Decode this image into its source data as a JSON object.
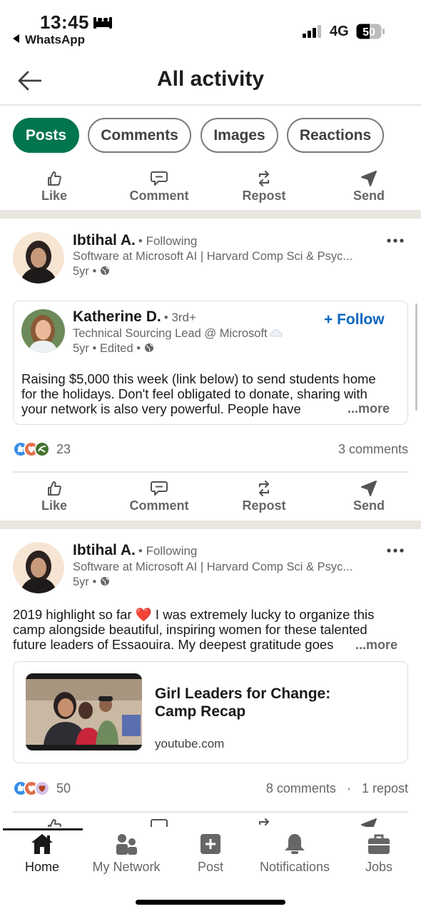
{
  "status_bar": {
    "time": "13:45",
    "back_app": "WhatsApp",
    "network": "4G",
    "battery": "50"
  },
  "header": {
    "title": "All activity"
  },
  "filters": [
    {
      "label": "Posts",
      "active": true
    },
    {
      "label": "Comments",
      "active": false
    },
    {
      "label": "Images",
      "active": false
    },
    {
      "label": "Reactions",
      "active": false
    }
  ],
  "action_labels": {
    "like": "Like",
    "comment": "Comment",
    "repost": "Repost",
    "send": "Send"
  },
  "posts": [
    {
      "author": "Ibtihal A.",
      "relation": "• Following",
      "headline": "Software at Microsoft AI | Harvard Comp Sci & Psyc...",
      "age": "5yr •",
      "reshared": {
        "author": "Katherine D.",
        "degree": "• 3rd+",
        "follow_label": "+ Follow",
        "headline": "Technical Sourcing Lead @ Microsoft",
        "age": "5yr • Edited •",
        "text_lines": [
          "Raising $5,000 this week (link below) to send students home",
          "for the holidays. Don't feel obligated to donate, sharing with",
          "your network is also very powerful. People have"
        ],
        "more": "...more"
      },
      "reaction_count": "23",
      "comments": "3 comments"
    },
    {
      "author": "Ibtihal A.",
      "relation": "• Following",
      "headline": "Software at Microsoft AI | Harvard Comp Sci & Psyc...",
      "age": "5yr •",
      "text_lines": [
        "2019 highlight so far ❤️ I was extremely lucky to organize this",
        "camp alongside beautiful, inspiring women for these talented",
        "future leaders of Essaouira. My deepest gratitude goes"
      ],
      "more": "...more",
      "link": {
        "title_line1": "Girl Leaders for Change:",
        "title_line2": "Camp Recap",
        "domain": "youtube.com"
      },
      "reaction_count": "50",
      "comments": "8 comments",
      "reposts": "1 repost"
    }
  ],
  "bottom_nav": [
    {
      "label": "Home",
      "icon": "home-icon",
      "active": true
    },
    {
      "label": "My Network",
      "icon": "network-icon",
      "active": false
    },
    {
      "label": "Post",
      "icon": "plus-square-icon",
      "active": false
    },
    {
      "label": "Notifications",
      "icon": "bell-icon",
      "active": false
    },
    {
      "label": "Jobs",
      "icon": "briefcase-icon",
      "active": false
    }
  ],
  "colors": {
    "accent_green": "#01754f",
    "link_blue": "#0a66c2",
    "muted": "#666666"
  }
}
